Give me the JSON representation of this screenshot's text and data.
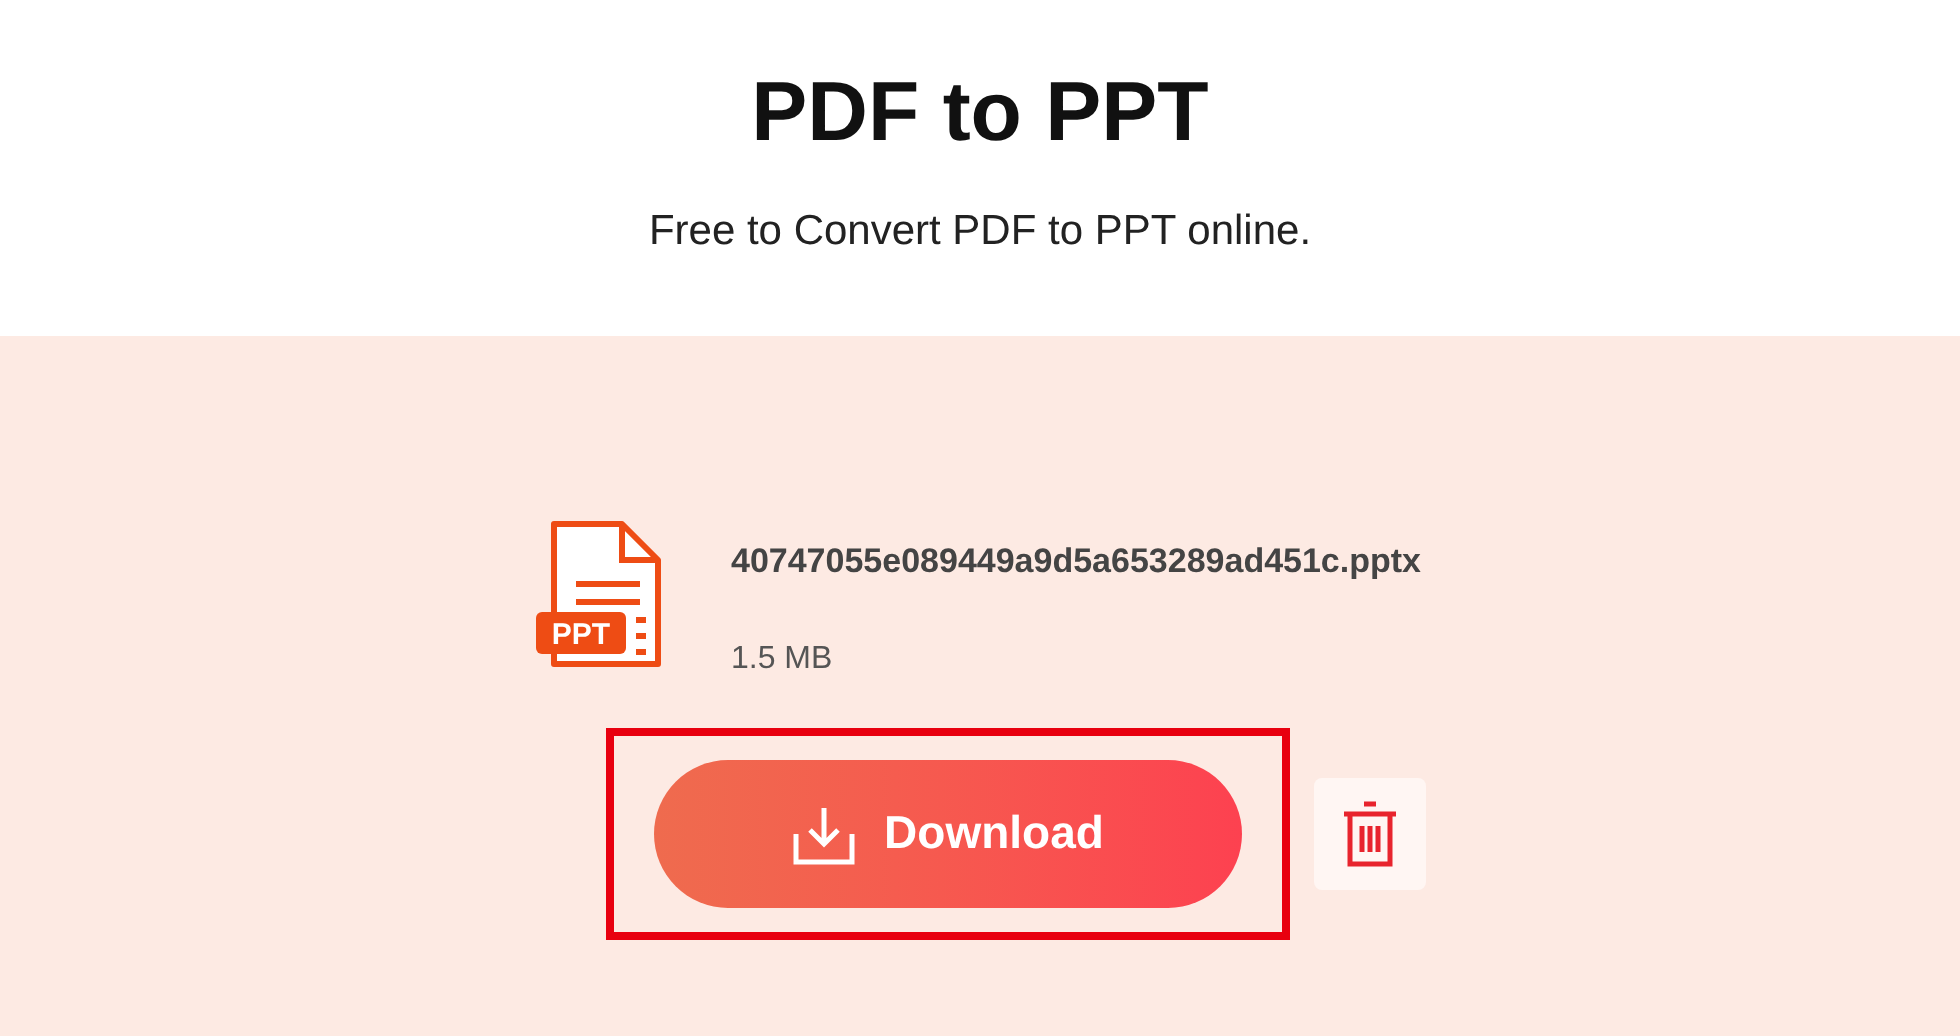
{
  "header": {
    "title": "PDF to PPT",
    "subtitle": "Free to Convert PDF to PPT online."
  },
  "file": {
    "badge": "PPT",
    "name": "40747055e089449a9d5a653289ad451c.pptx",
    "size": "1.5 MB"
  },
  "actions": {
    "download": "Download",
    "highlighted": true
  }
}
